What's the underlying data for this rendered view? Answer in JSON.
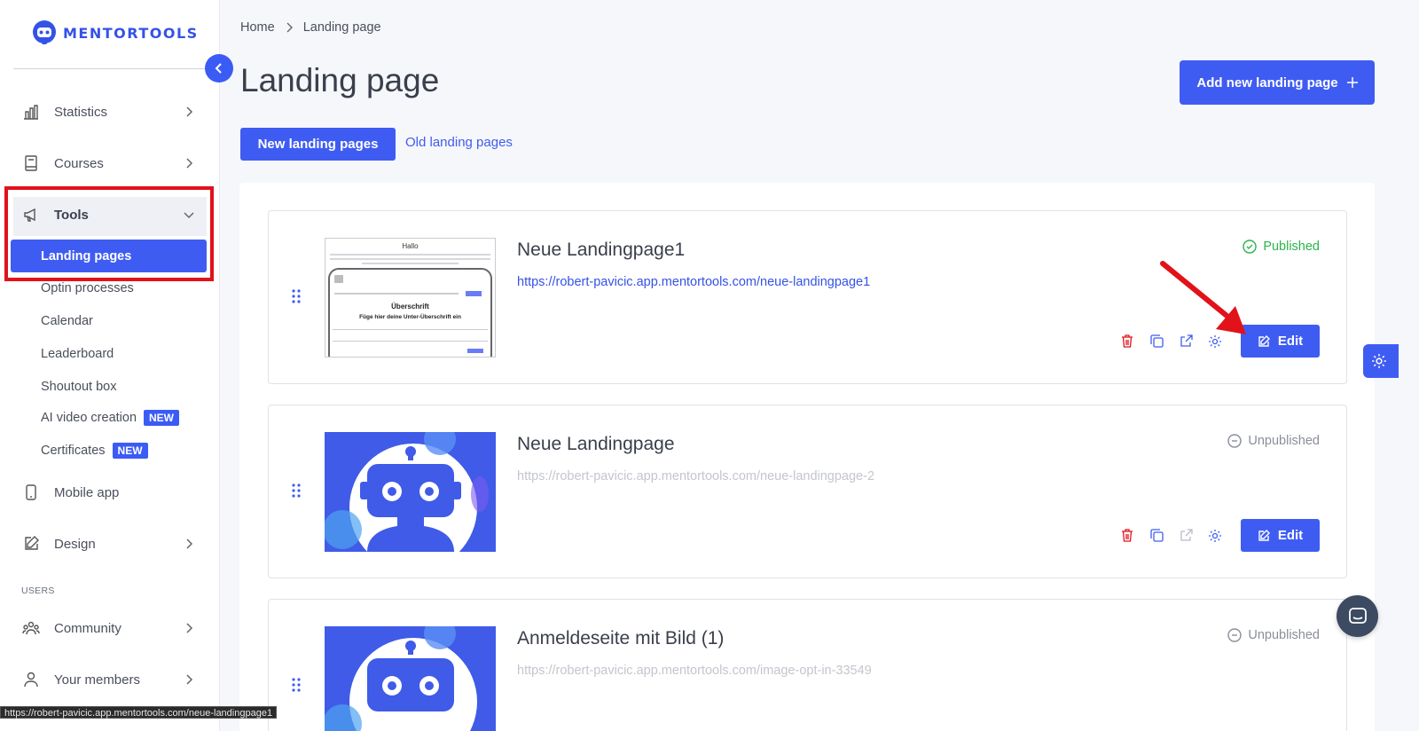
{
  "brand": {
    "name": "MENTORTOOLS",
    "accent": "#3f5cf2"
  },
  "sidebar": {
    "items": [
      {
        "label": "Statistics",
        "icon": "bar-chart-icon"
      },
      {
        "label": "Courses",
        "icon": "book-icon"
      },
      {
        "label": "Tools",
        "icon": "megaphone-icon"
      },
      {
        "label": "Mobile app",
        "icon": "smartphone-icon"
      },
      {
        "label": "Design",
        "icon": "pencil-square-icon"
      },
      {
        "label": "Community",
        "icon": "people-icon"
      },
      {
        "label": "Your members",
        "icon": "user-icon"
      }
    ],
    "tools_sub": [
      {
        "label": "Landing pages",
        "active": true
      },
      {
        "label": "Optin processes"
      },
      {
        "label": "Calendar"
      },
      {
        "label": "Leaderboard"
      },
      {
        "label": "Shoutout box"
      },
      {
        "label": "AI video creation",
        "badge": "NEW"
      },
      {
        "label": "Certificates",
        "badge": "NEW"
      }
    ],
    "section_users": "USERS"
  },
  "breadcrumb": {
    "home": "Home",
    "current": "Landing page"
  },
  "page": {
    "title": "Landing page",
    "add_button": "Add new landing page",
    "tab_new": "New landing pages",
    "tab_old": "Old landing pages"
  },
  "cards": [
    {
      "title": "Neue Landingpage1",
      "url": "https://robert-pavicic.app.mentortools.com/neue-landingpage1",
      "status": "Published",
      "edit": "Edit",
      "thumb": {
        "heading": "Hallo",
        "sub1": "Überschrift",
        "sub2": "Füge hier deine Unter-Überschrift ein"
      }
    },
    {
      "title": "Neue Landingpage",
      "url": "https://robert-pavicic.app.mentortools.com/neue-landingpage-2",
      "status": "Unpublished",
      "edit": "Edit"
    },
    {
      "title": "Anmeldeseite mit Bild (1)",
      "url": "https://robert-pavicic.app.mentortools.com/image-opt-in-33549",
      "status": "Unpublished",
      "edit": "Edit"
    }
  ],
  "status_bar": "https://robert-pavicic.app.mentortools.com/neue-landingpage1",
  "colors": {
    "published": "#2bb34a",
    "danger": "#e1121a"
  }
}
